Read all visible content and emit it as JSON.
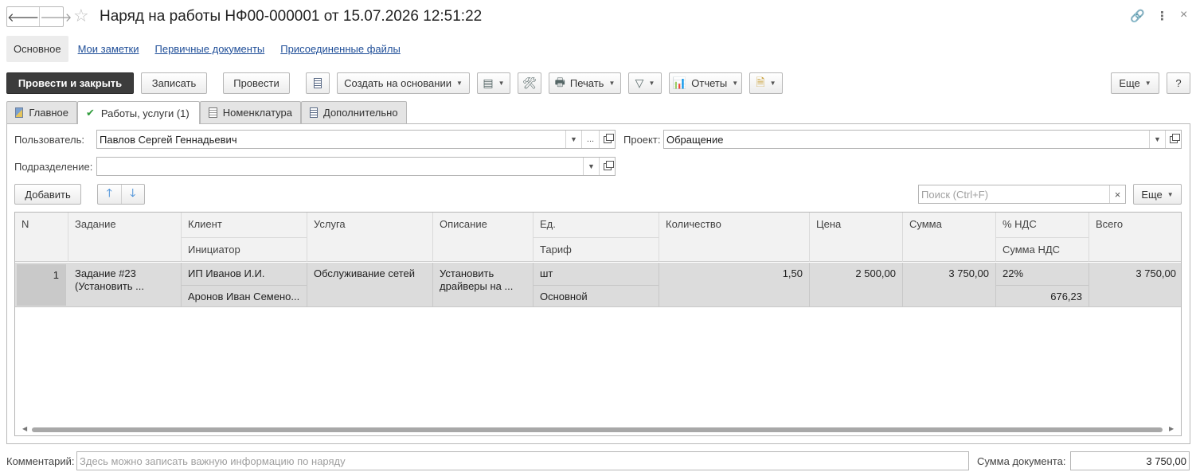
{
  "window": {
    "title": "Наряд на работы НФ00-000001 от 15.07.2026 12:51:22",
    "back_glyph": "🡐",
    "fwd_glyph": "🡒",
    "star_glyph": "☆",
    "link_glyph": "🔗",
    "menu_glyph": "⋮",
    "close_glyph": "×"
  },
  "section_nav": {
    "main": "Основное",
    "notes": "Мои заметки",
    "primary_docs": "Первичные документы",
    "attached_files": "Присоединенные файлы"
  },
  "toolbar": {
    "post_close": "Провести и закрыть",
    "save": "Записать",
    "post": "Провести",
    "create_based": "Создать на основании",
    "print": "Печать",
    "reports": "Отчеты",
    "more": "Еще",
    "help": "?"
  },
  "tabs": {
    "main": "Главное",
    "works": "Работы, услуги (1)",
    "nomenclature": "Номенклатура",
    "additional": "Дополнительно"
  },
  "form": {
    "user_label": "Пользователь:",
    "user_value": "Павлов Сергей Геннадьевич",
    "project_label": "Проект:",
    "project_value": "Обращение",
    "division_label": "Подразделение:",
    "division_value": "",
    "ellipsis": "..."
  },
  "table_toolbar": {
    "add": "Добавить",
    "search_placeholder": "Поиск (Ctrl+F)",
    "search_clear": "×",
    "more": "Еще"
  },
  "table": {
    "headers": {
      "n": "N",
      "task": "Задание",
      "client": "Клиент",
      "initiator": "Инициатор",
      "service": "Услуга",
      "description": "Описание",
      "unit": "Ед.",
      "tariff": "Тариф",
      "quantity": "Количество",
      "price": "Цена",
      "sum": "Сумма",
      "vat_rate": "% НДС",
      "vat_sum": "Сумма НДС",
      "total": "Всего"
    },
    "rows": [
      {
        "n": "1",
        "task": "Задание #23 (Установить ...",
        "client": "ИП Иванов И.И.",
        "initiator": "Аронов Иван Семено...",
        "service": "Обслуживание сетей",
        "description": "Установить драйверы на ...",
        "unit": "шт",
        "tariff": "Основной",
        "quantity": "1,50",
        "price": "2 500,00",
        "sum": "3 750,00",
        "vat_rate": "22%",
        "vat_sum": "676,23",
        "total": "3 750,00"
      }
    ]
  },
  "footer": {
    "comment_label": "Комментарий:",
    "comment_placeholder": "Здесь можно записать важную информацию по наряду",
    "doc_sum_label": "Сумма документа:",
    "doc_sum_value": "3 750,00"
  }
}
